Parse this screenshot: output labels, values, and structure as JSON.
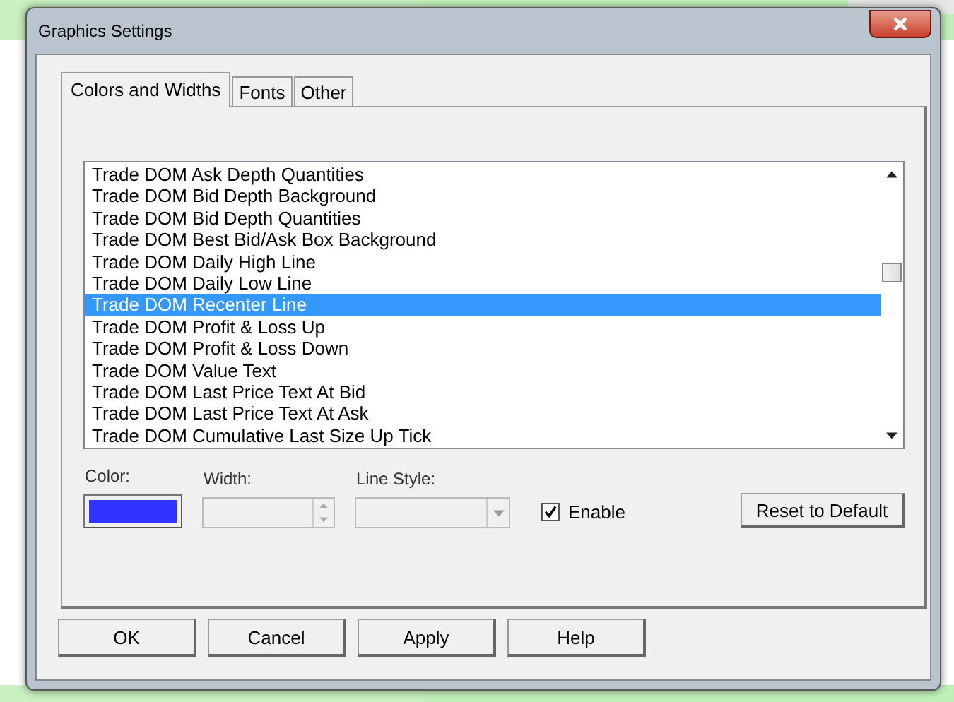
{
  "window": {
    "title": "Graphics Settings"
  },
  "tabs": [
    {
      "label": "Colors and Widths",
      "selected": true
    },
    {
      "label": "Fonts",
      "selected": false
    },
    {
      "label": "Other",
      "selected": false
    }
  ],
  "list": {
    "items": [
      {
        "label": "Trade DOM Ask Depth Quantities",
        "selected": false
      },
      {
        "label": "Trade DOM Bid Depth Background",
        "selected": false
      },
      {
        "label": "Trade DOM Bid Depth Quantities",
        "selected": false
      },
      {
        "label": "Trade DOM Best Bid/Ask Box Background",
        "selected": false
      },
      {
        "label": "Trade DOM Daily High Line",
        "selected": false
      },
      {
        "label": "Trade DOM Daily Low Line",
        "selected": false
      },
      {
        "label": "Trade DOM Recenter Line",
        "selected": true
      },
      {
        "label": "Trade DOM Profit & Loss Up",
        "selected": false
      },
      {
        "label": "Trade DOM Profit & Loss Down",
        "selected": false
      },
      {
        "label": "Trade DOM Value Text",
        "selected": false
      },
      {
        "label": "Trade DOM Last Price Text At Bid",
        "selected": false
      },
      {
        "label": "Trade DOM Last Price Text At Ask",
        "selected": false
      },
      {
        "label": "Trade DOM Cumulative Last Size Up Tick",
        "selected": false
      }
    ]
  },
  "color": {
    "label": "Color:",
    "color": "#3333ff"
  },
  "width": {
    "label": "Width:",
    "disabled": true
  },
  "line_style": {
    "label": "Line Style:",
    "disabled": true
  },
  "enable": {
    "label": "Enable",
    "checked": true
  },
  "reset_button": "Reset to Default",
  "buttons": [
    "OK",
    "Cancel",
    "Apply",
    "Help"
  ]
}
